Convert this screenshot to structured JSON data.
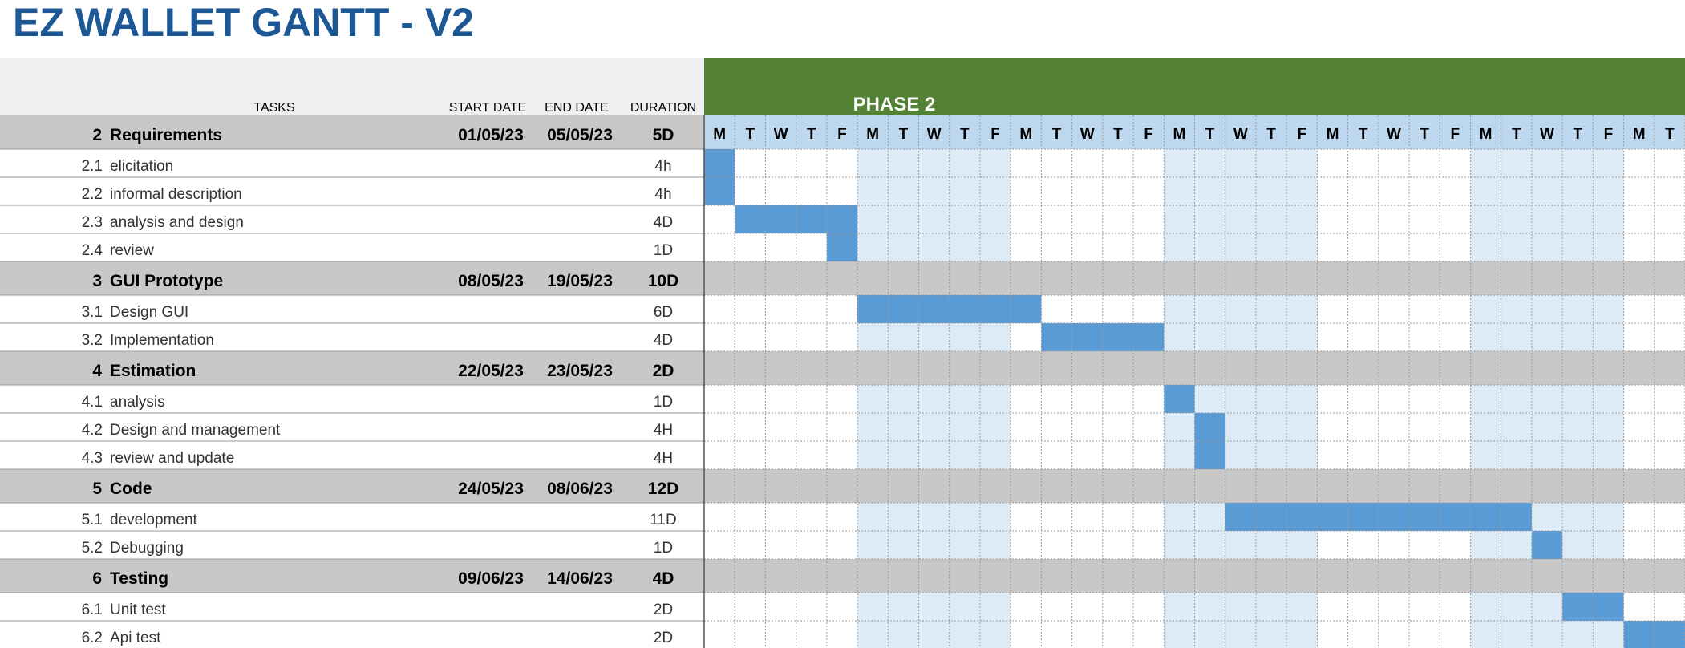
{
  "title": "EZ WALLET GANTT - V2",
  "colors": {
    "title": "#1c5796",
    "phase_band": "#548235",
    "day_header": "#bdd7ee",
    "weekend_band": "#ddebf7",
    "task_bar": "#5b9bd5",
    "group_row": "#c8c8c8",
    "header_bg": "#efefef"
  },
  "chart_data": {
    "type": "gantt",
    "columns": {
      "tasks": "TASKS",
      "start": "START DATE",
      "end": "END DATE",
      "duration": "DURATION"
    },
    "phase": "PHASE 2",
    "days": [
      "M",
      "T",
      "W",
      "T",
      "F",
      "M",
      "T",
      "W",
      "T",
      "F",
      "M",
      "T",
      "W",
      "T",
      "F",
      "M",
      "T",
      "W",
      "T",
      "F",
      "M",
      "T",
      "W",
      "T",
      "F",
      "M",
      "T",
      "W",
      "T",
      "F",
      "M",
      "T"
    ],
    "rows": [
      {
        "kind": "group",
        "num": "2",
        "name": "Requirements",
        "start": "01/05/23",
        "end": "05/05/23",
        "duration": "5D"
      },
      {
        "kind": "task",
        "num": "2.1",
        "name": "elicitation",
        "duration": "4h",
        "bar": [
          0,
          0
        ]
      },
      {
        "kind": "task",
        "num": "2.2",
        "name": "informal description",
        "duration": "4h",
        "bar": [
          0,
          0
        ]
      },
      {
        "kind": "task",
        "num": "2.3",
        "name": "analysis and design",
        "duration": "4D",
        "bar": [
          1,
          4
        ]
      },
      {
        "kind": "task",
        "num": "2.4",
        "name": "review",
        "duration": "1D",
        "bar": [
          4,
          4
        ]
      },
      {
        "kind": "group",
        "num": "3",
        "name": "GUI Prototype",
        "start": "08/05/23",
        "end": "19/05/23",
        "duration": "10D"
      },
      {
        "kind": "task",
        "num": "3.1",
        "name": "Design GUI",
        "duration": "6D",
        "bar": [
          5,
          10
        ]
      },
      {
        "kind": "task",
        "num": "3.2",
        "name": "Implementation",
        "duration": "4D",
        "bar": [
          11,
          14
        ]
      },
      {
        "kind": "group",
        "num": "4",
        "name": "Estimation",
        "start": "22/05/23",
        "end": "23/05/23",
        "duration": "2D"
      },
      {
        "kind": "task",
        "num": "4.1",
        "name": "analysis",
        "duration": "1D",
        "bar": [
          15,
          15
        ]
      },
      {
        "kind": "task",
        "num": "4.2",
        "name": "Design and management",
        "duration": "4H",
        "bar": [
          16,
          16
        ]
      },
      {
        "kind": "task",
        "num": "4.3",
        "name": "review and update",
        "duration": "4H",
        "bar": [
          16,
          16
        ]
      },
      {
        "kind": "group",
        "num": "5",
        "name": "Code",
        "start": "24/05/23",
        "end": "08/06/23",
        "duration": "12D"
      },
      {
        "kind": "task",
        "num": "5.1",
        "name": "development",
        "duration": "11D",
        "bar": [
          17,
          26
        ]
      },
      {
        "kind": "task",
        "num": "5.2",
        "name": "Debugging",
        "duration": "1D",
        "bar": [
          27,
          27
        ]
      },
      {
        "kind": "group",
        "num": "6",
        "name": "Testing",
        "start": "09/06/23",
        "end": "14/06/23",
        "duration": "4D"
      },
      {
        "kind": "task",
        "num": "6.1",
        "name": "Unit test",
        "duration": "2D",
        "bar": [
          28,
          29
        ]
      },
      {
        "kind": "task",
        "num": "6.2",
        "name": "Api test",
        "duration": "2D",
        "bar": [
          30,
          31
        ]
      }
    ]
  }
}
